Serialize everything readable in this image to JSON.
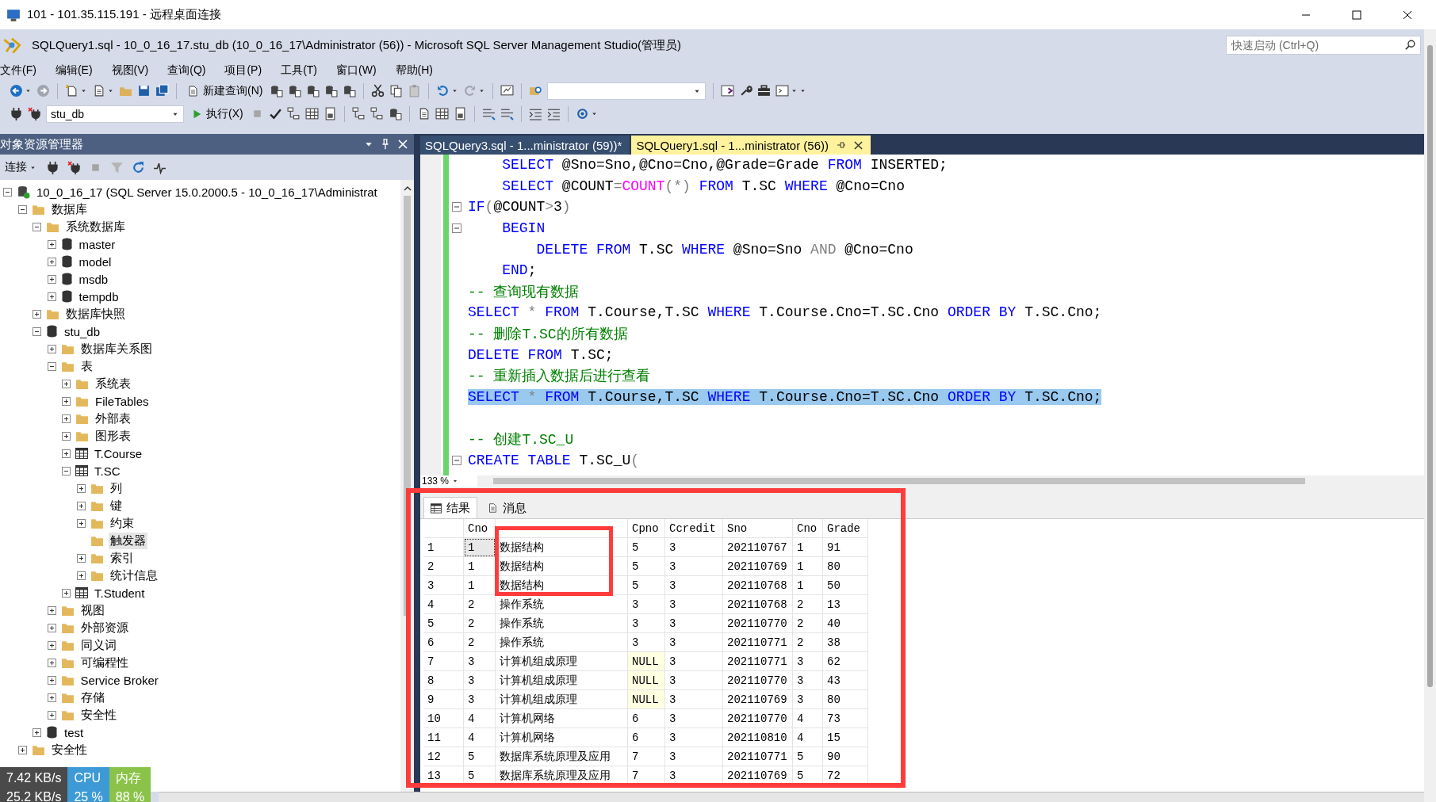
{
  "remote_window": {
    "title": "101 - 101.35.115.191 - 远程桌面连接"
  },
  "window": {
    "title": "SQLQuery1.sql - 10_0_16_17.stu_db (10_0_16_17\\Administrator (56)) - Microsoft SQL Server Management Studio(管理员)",
    "quick_launch": {
      "placeholder": "快速启动 (Ctrl+Q)"
    }
  },
  "menu": [
    "文件(F)",
    "编辑(E)",
    "视图(V)",
    "查询(Q)",
    "项目(P)",
    "工具(T)",
    "窗口(W)",
    "帮助(H)"
  ],
  "toolbar": {
    "new_query": "新建查询(N)",
    "database": "stu_db",
    "execute": "执行(X)"
  },
  "object_explorer": {
    "title": "对象资源管理器",
    "connect": "连接",
    "tree": [
      {
        "label": "10_0_16_17 (SQL Server 15.0.2000.5 - 10_0_16_17\\Administrat",
        "kind": "server",
        "expanded": true,
        "selected": false,
        "children": [
          {
            "label": "数据库",
            "kind": "folder",
            "expanded": true,
            "selected": false,
            "children": [
              {
                "label": "系统数据库",
                "kind": "folder",
                "expanded": true,
                "selected": false,
                "children": [
                  {
                    "label": "master",
                    "kind": "database",
                    "expanded": false,
                    "selected": false
                  },
                  {
                    "label": "model",
                    "kind": "database",
                    "expanded": false,
                    "selected": false
                  },
                  {
                    "label": "msdb",
                    "kind": "database",
                    "expanded": false,
                    "selected": false
                  },
                  {
                    "label": "tempdb",
                    "kind": "database",
                    "expanded": false,
                    "selected": false
                  }
                ]
              },
              {
                "label": "数据库快照",
                "kind": "folder",
                "expanded": false,
                "selected": false
              },
              {
                "label": "stu_db",
                "kind": "database",
                "expanded": true,
                "selected": false,
                "children": [
                  {
                    "label": "数据库关系图",
                    "kind": "folder",
                    "expanded": false,
                    "selected": false
                  },
                  {
                    "label": "表",
                    "kind": "folder",
                    "expanded": true,
                    "selected": false,
                    "children": [
                      {
                        "label": "系统表",
                        "kind": "folder",
                        "expanded": false,
                        "selected": false
                      },
                      {
                        "label": "FileTables",
                        "kind": "folder",
                        "expanded": false,
                        "selected": false
                      },
                      {
                        "label": "外部表",
                        "kind": "folder",
                        "expanded": false,
                        "selected": false
                      },
                      {
                        "label": "图形表",
                        "kind": "folder",
                        "expanded": false,
                        "selected": false
                      },
                      {
                        "label": "T.Course",
                        "kind": "table",
                        "expanded": false,
                        "selected": false
                      },
                      {
                        "label": "T.SC",
                        "kind": "table",
                        "expanded": true,
                        "selected": false,
                        "children": [
                          {
                            "label": "列",
                            "kind": "folder",
                            "expanded": false,
                            "selected": false
                          },
                          {
                            "label": "键",
                            "kind": "folder",
                            "expanded": false,
                            "selected": false
                          },
                          {
                            "label": "约束",
                            "kind": "folder",
                            "expanded": false,
                            "selected": false
                          },
                          {
                            "label": "触发器",
                            "kind": "folder",
                            "selected": true
                          },
                          {
                            "label": "索引",
                            "kind": "folder",
                            "expanded": false,
                            "selected": false
                          },
                          {
                            "label": "统计信息",
                            "kind": "folder",
                            "expanded": false,
                            "selected": false
                          }
                        ]
                      },
                      {
                        "label": "T.Student",
                        "kind": "table",
                        "expanded": false,
                        "selected": false
                      }
                    ]
                  },
                  {
                    "label": "视图",
                    "kind": "folder",
                    "expanded": false,
                    "selected": false
                  },
                  {
                    "label": "外部资源",
                    "kind": "folder",
                    "expanded": false,
                    "selected": false
                  },
                  {
                    "label": "同义词",
                    "kind": "folder",
                    "expanded": false,
                    "selected": false
                  },
                  {
                    "label": "可编程性",
                    "kind": "folder",
                    "expanded": false,
                    "selected": false
                  },
                  {
                    "label": "Service Broker",
                    "kind": "folder",
                    "expanded": false,
                    "selected": false
                  },
                  {
                    "label": "存储",
                    "kind": "folder",
                    "expanded": false,
                    "selected": false
                  },
                  {
                    "label": "安全性",
                    "kind": "folder",
                    "expanded": false,
                    "selected": false
                  }
                ]
              },
              {
                "label": "test",
                "kind": "database",
                "expanded": false,
                "selected": false
              }
            ]
          },
          {
            "label": "安全性",
            "kind": "folder",
            "expanded": false,
            "selected": false
          }
        ]
      }
    ]
  },
  "editor_tabs": [
    {
      "label": "SQLQuery3.sql - 1...ministrator (59))*",
      "selected": false
    },
    {
      "label": "SQLQuery1.sql - 1...ministrator (56))",
      "selected": true
    }
  ],
  "code_lines": [
    {
      "fold": false,
      "selected": false,
      "tokens": [
        {
          "kind": "keyword",
          "text": "    SELECT"
        },
        {
          "kind": "text",
          "text": " @Sno=Sno,@Cno=Cno,@Grade=Grade "
        },
        {
          "kind": "keyword",
          "text": "FROM"
        },
        {
          "kind": "text",
          "text": " INSERTED;"
        }
      ]
    },
    {
      "fold": false,
      "selected": false,
      "tokens": [
        {
          "kind": "keyword",
          "text": "    SELECT"
        },
        {
          "kind": "text",
          "text": " @COUNT"
        },
        {
          "kind": "operator",
          "text": "="
        },
        {
          "kind": "function",
          "text": "COUNT"
        },
        {
          "kind": "operator",
          "text": "(*)"
        },
        {
          "kind": "keyword",
          "text": " FROM"
        },
        {
          "kind": "text",
          "text": " T.SC "
        },
        {
          "kind": "keyword",
          "text": "WHERE"
        },
        {
          "kind": "text",
          "text": " @Cno=Cno"
        }
      ]
    },
    {
      "fold": true,
      "selected": false,
      "tokens": [
        {
          "kind": "keyword",
          "text": "IF"
        },
        {
          "kind": "operator",
          "text": "("
        },
        {
          "kind": "text",
          "text": "@COUNT"
        },
        {
          "kind": "operator",
          "text": ">"
        },
        {
          "kind": "text",
          "text": "3"
        },
        {
          "kind": "operator",
          "text": ")"
        }
      ]
    },
    {
      "fold": true,
      "selected": false,
      "tokens": [
        {
          "kind": "keyword",
          "text": "    BEGIN"
        }
      ]
    },
    {
      "fold": false,
      "selected": false,
      "tokens": [
        {
          "kind": "keyword",
          "text": "        DELETE FROM"
        },
        {
          "kind": "text",
          "text": " T.SC "
        },
        {
          "kind": "keyword",
          "text": "WHERE"
        },
        {
          "kind": "text",
          "text": " @Sno=Sno "
        },
        {
          "kind": "operator",
          "text": "AND"
        },
        {
          "kind": "text",
          "text": " @Cno=Cno"
        }
      ]
    },
    {
      "fold": false,
      "selected": false,
      "tokens": [
        {
          "kind": "keyword",
          "text": "    END"
        },
        {
          "kind": "text",
          "text": ";"
        }
      ]
    },
    {
      "fold": false,
      "selected": false,
      "tokens": [
        {
          "kind": "comment",
          "text": "-- 查询现有数据"
        }
      ]
    },
    {
      "fold": false,
      "selected": false,
      "tokens": [
        {
          "kind": "keyword",
          "text": "SELECT"
        },
        {
          "kind": "operator",
          "text": " * "
        },
        {
          "kind": "keyword",
          "text": "FROM"
        },
        {
          "kind": "text",
          "text": " T.Course,T.SC "
        },
        {
          "kind": "keyword",
          "text": "WHERE"
        },
        {
          "kind": "text",
          "text": " T.Course.Cno=T.SC.Cno "
        },
        {
          "kind": "keyword",
          "text": "ORDER BY"
        },
        {
          "kind": "text",
          "text": " T.SC.Cno;"
        }
      ]
    },
    {
      "fold": false,
      "selected": false,
      "tokens": [
        {
          "kind": "comment",
          "text": "-- 删除T.SC的所有数据"
        }
      ]
    },
    {
      "fold": false,
      "selected": false,
      "tokens": [
        {
          "kind": "keyword",
          "text": "DELETE FROM"
        },
        {
          "kind": "text",
          "text": " T.SC;"
        }
      ]
    },
    {
      "fold": false,
      "selected": false,
      "tokens": [
        {
          "kind": "comment",
          "text": "-- 重新插入数据后进行查看"
        }
      ]
    },
    {
      "fold": false,
      "selected": true,
      "tokens": [
        {
          "kind": "keyword",
          "text": "SELECT"
        },
        {
          "kind": "operator",
          "text": " * "
        },
        {
          "kind": "keyword",
          "text": "FROM"
        },
        {
          "kind": "text",
          "text": " T.Course,T.SC "
        },
        {
          "kind": "keyword",
          "text": "WHERE"
        },
        {
          "kind": "text",
          "text": " T.Course.Cno=T.SC.Cno "
        },
        {
          "kind": "keyword",
          "text": "ORDER BY"
        },
        {
          "kind": "text",
          "text": " T.SC.Cno;"
        }
      ]
    },
    {
      "fold": false
    },
    {
      "fold": false,
      "selected": false,
      "tokens": [
        {
          "kind": "comment",
          "text": "-- 创建T.SC_U"
        }
      ]
    },
    {
      "fold": true,
      "selected": false,
      "tokens": [
        {
          "kind": "keyword",
          "text": "CREATE TABLE"
        },
        {
          "kind": "text",
          "text": " T.SC_U"
        },
        {
          "kind": "operator",
          "text": "("
        }
      ]
    }
  ],
  "zoom": "133 %",
  "result_tabs": [
    {
      "label": "结果",
      "kind": "grid",
      "selected": true
    },
    {
      "label": "消息",
      "kind": "messages",
      "selected": false
    }
  ],
  "results": {
    "columns": [
      {
        "label": "Cno"
      },
      {},
      {
        "label": "Cpno"
      },
      {
        "label": "Ccredit"
      },
      {
        "label": "Sno"
      },
      {
        "label": "Cno"
      },
      {
        "label": "Grade"
      }
    ],
    "rows": [
      {
        "number": "1",
        "focused": true,
        "cells": [
          "1",
          "数据结构",
          "5",
          "3",
          "202110767",
          "1",
          "91"
        ]
      },
      {
        "number": "2",
        "focused": false,
        "cells": [
          "1",
          "数据结构",
          "5",
          "3",
          "202110769",
          "1",
          "80"
        ]
      },
      {
        "number": "3",
        "focused": false,
        "cells": [
          "1",
          "数据结构",
          "5",
          "3",
          "202110768",
          "1",
          "50"
        ]
      },
      {
        "number": "4",
        "focused": false,
        "cells": [
          "2",
          "操作系统",
          "3",
          "3",
          "202110768",
          "2",
          "13"
        ]
      },
      {
        "number": "5",
        "focused": false,
        "cells": [
          "2",
          "操作系统",
          "3",
          "3",
          "202110770",
          "2",
          "40"
        ]
      },
      {
        "number": "6",
        "focused": false,
        "cells": [
          "2",
          "操作系统",
          "3",
          "3",
          "202110771",
          "2",
          "38"
        ]
      },
      {
        "number": "7",
        "focused": false,
        "cells": [
          "3",
          "计算机组成原理",
          {
            "text": "NULL",
            "null": true
          },
          "3",
          "202110771",
          "3",
          "62"
        ]
      },
      {
        "number": "8",
        "focused": false,
        "cells": [
          "3",
          "计算机组成原理",
          {
            "text": "NULL",
            "null": true
          },
          "3",
          "202110770",
          "3",
          "43"
        ]
      },
      {
        "number": "9",
        "focused": false,
        "cells": [
          "3",
          "计算机组成原理",
          {
            "text": "NULL",
            "null": true
          },
          "3",
          "202110769",
          "3",
          "80"
        ]
      },
      {
        "number": "10",
        "focused": false,
        "cells": [
          "4",
          "计算机网络",
          "6",
          "3",
          "202110770",
          "4",
          "73"
        ]
      },
      {
        "number": "11",
        "focused": false,
        "cells": [
          "4",
          "计算机网络",
          "6",
          "3",
          "202110810",
          "4",
          "15"
        ]
      },
      {
        "number": "12",
        "focused": false,
        "cells": [
          "5",
          "数据库系统原理及应用",
          "7",
          "3",
          "202110771",
          "5",
          "90"
        ]
      },
      {
        "number": "13",
        "focused": false,
        "cells": [
          "5",
          "数据库系统原理及应用",
          "7",
          "3",
          "202110769",
          "5",
          "72"
        ]
      }
    ]
  },
  "monitor": {
    "upload": "7.42 KB/s",
    "download": "25.2 KB/s",
    "cpu_label": "CPU",
    "cpu": "25 %",
    "memory_label": "内存",
    "memory": "88 %"
  }
}
